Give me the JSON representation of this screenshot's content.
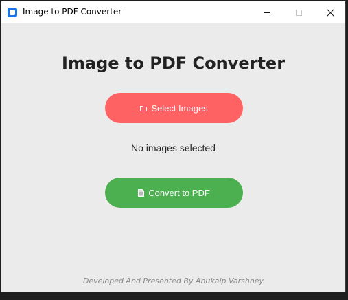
{
  "window": {
    "title": "Image to PDF Converter"
  },
  "main": {
    "heading": "Image to PDF Converter",
    "select_button_label": "Select Images",
    "status_text": "No images selected",
    "convert_button_label": "Convert to PDF"
  },
  "footer": {
    "credit": "Developed And Presented By Anukalp Varshney"
  },
  "colors": {
    "select_button": "#ff6262",
    "convert_button": "#4caf50",
    "background": "#ebebeb",
    "app_icon": "#1a73e8"
  },
  "icons": {
    "select_button_icon": "folder-icon",
    "convert_button_icon": "document-icon"
  }
}
